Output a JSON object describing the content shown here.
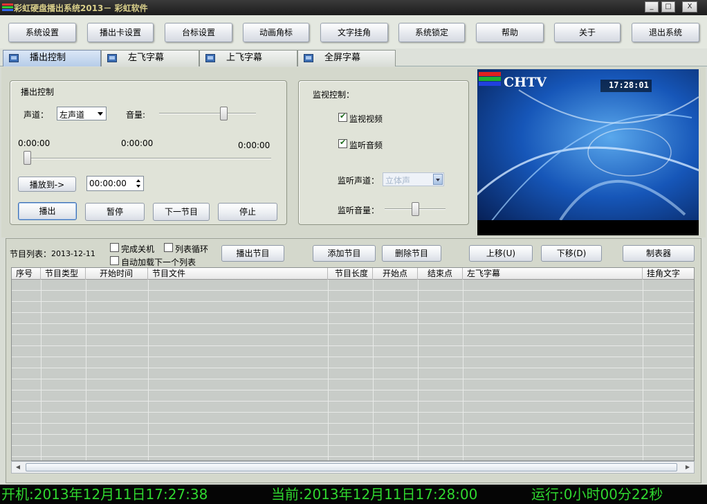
{
  "window": {
    "title": "彩虹硬盘播出系统2013－ 彩虹软件",
    "minimize_label": "_",
    "maximize_label": "□",
    "close_label": "X"
  },
  "toolbar": {
    "buttons": [
      "系统设置",
      "播出卡设置",
      "台标设置",
      "动画角标",
      "文字挂角",
      "系统锁定",
      "帮助",
      "关于",
      "退出系统"
    ]
  },
  "tabs": [
    "播出控制",
    "左飞字幕",
    "上飞字幕",
    "全屏字幕"
  ],
  "playback": {
    "group_title": "播出控制",
    "channel_label": "声道：",
    "channel_value": "左声道",
    "volume_label": "音量:",
    "volume_level": 0.68,
    "time_start": "0:00:00",
    "time_mid": "0:00:00",
    "time_end": "0:00:00",
    "progress": 0.0,
    "seek_button": "播放到->",
    "seek_time": "00:00:00",
    "play_button": "播出",
    "pause_button": "暂停",
    "next_button": "下一节目",
    "stop_button": "停止"
  },
  "monitor": {
    "group_title": "监视控制：",
    "video_label": "监视视频",
    "video_checked": true,
    "audio_label": "监听音频",
    "audio_checked": true,
    "channel_label": "监听声道：",
    "channel_value": "立体声",
    "volume_label": "监听音量：",
    "volume_level": 0.5
  },
  "preview": {
    "logo_text": "CHTV",
    "clock": "17:28:01"
  },
  "playlist": {
    "label": "节目列表：",
    "date": "2013-12-11",
    "shutdown_label": "完成关机",
    "shutdown_checked": false,
    "loop_label": "列表循环",
    "loop_checked": false,
    "autoload_label": "自动加载下一个列表",
    "autoload_checked": false,
    "play_button": "播出节目",
    "add_button": "添加节目",
    "delete_button": "删除节目",
    "up_button": "上移(U)",
    "down_button": "下移(D)",
    "schedule_button": "制表器",
    "columns": [
      "序号",
      "节目类型",
      "开始时间",
      "节目文件",
      "节目长度",
      "开始点",
      "结束点",
      "左飞字幕",
      "挂角文字"
    ]
  },
  "status": {
    "boot": "开机:2013年12月11日17:27:38",
    "current": "当前:2013年12月11日17:28:00",
    "running": "运行:0小时00分22秒"
  },
  "colors": {
    "status_text": "#2fd82f",
    "status_bg": "#050505",
    "titlebar_bg": "#2a2a2a"
  }
}
